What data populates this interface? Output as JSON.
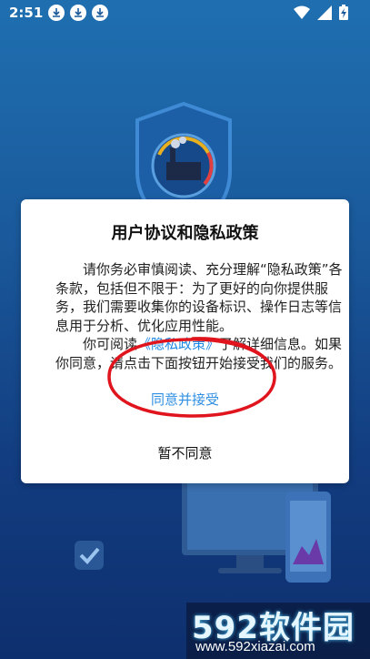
{
  "status_bar": {
    "time": "2:51",
    "download_notifications": [
      "download-icon",
      "download-icon",
      "download-icon"
    ],
    "right_icons": [
      "wifi-icon",
      "signal-icon",
      "battery-charging-icon"
    ]
  },
  "dialog": {
    "title": "用户协议和隐私政策",
    "paragraph1": "请你务必审慎阅读、充分理解“隐私政策”各条款，包括但不限于：为了更好的向你提供服务，我们需要收集你的设备标识、操作日志等信息用于分析、优化应用性能。",
    "paragraph2_prefix": "你可阅读",
    "privacy_link": "《隐私政策》",
    "paragraph2_suffix": "了解详细信息。如果你同意，请点击下面按钮开始接受我们的服务。",
    "agree_label": "同意并接受",
    "disagree_label": "暂不同意"
  },
  "watermark": {
    "logo": "592软件园",
    "url": "www.592xiazai.com"
  },
  "colors": {
    "link": "#1e88e5",
    "agree": "#2f8fe3",
    "annotation_ellipse": "#e0141c"
  }
}
